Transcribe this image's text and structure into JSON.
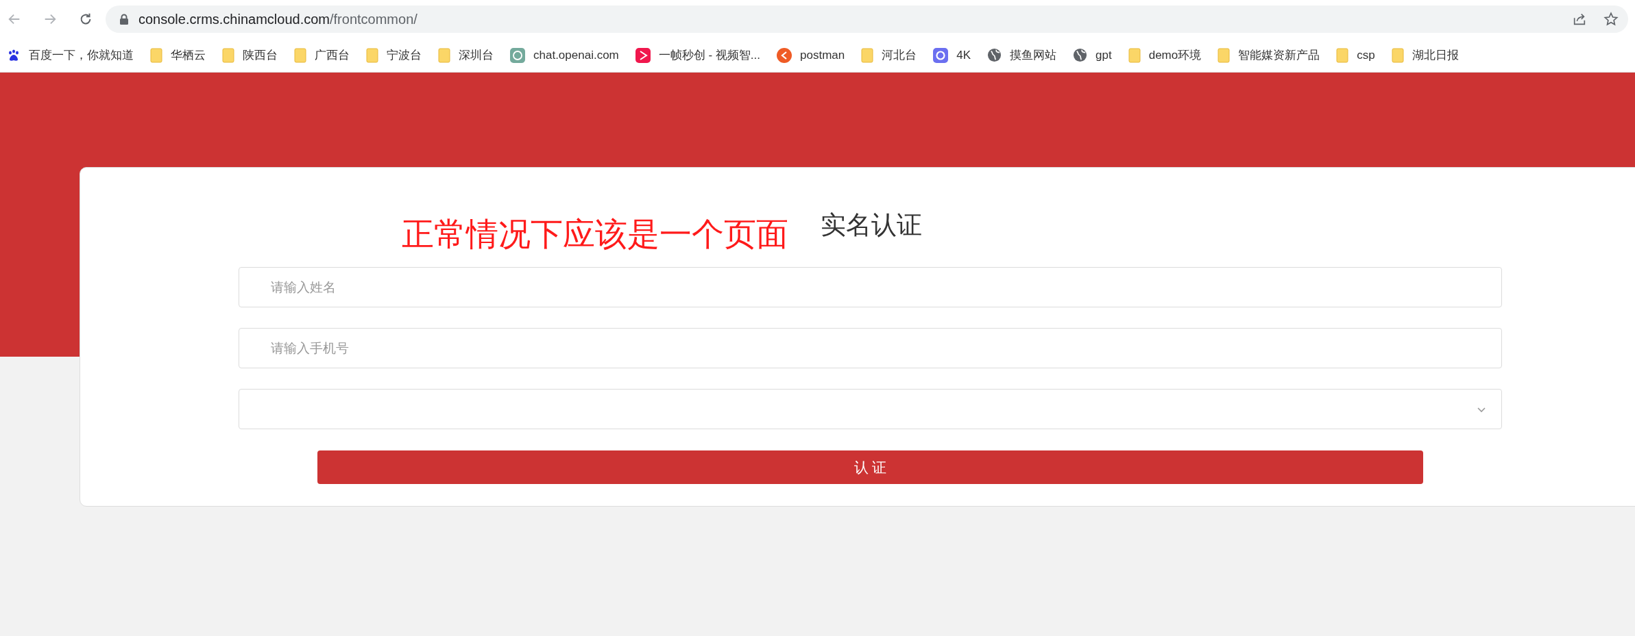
{
  "browser": {
    "url_host": "console.crms.chinamcloud.com",
    "url_path": "/frontcommon/"
  },
  "bookmarks": [
    {
      "label": "百度一下，你就知道",
      "kind": "paw"
    },
    {
      "label": "华栖云",
      "kind": "folder"
    },
    {
      "label": "陕西台",
      "kind": "folder"
    },
    {
      "label": "广西台",
      "kind": "folder"
    },
    {
      "label": "宁波台",
      "kind": "folder"
    },
    {
      "label": "深圳台",
      "kind": "folder"
    },
    {
      "label": "chat.openai.com",
      "kind": "knot"
    },
    {
      "label": "一帧秒创 - 视频智...",
      "kind": "play"
    },
    {
      "label": "postman",
      "kind": "rocket"
    },
    {
      "label": "河北台",
      "kind": "folder"
    },
    {
      "label": "4K",
      "kind": "ring"
    },
    {
      "label": "摸鱼网站",
      "kind": "globe"
    },
    {
      "label": "gpt",
      "kind": "globe"
    },
    {
      "label": "demo环境",
      "kind": "folder"
    },
    {
      "label": "智能媒资新产品",
      "kind": "folder"
    },
    {
      "label": "csp",
      "kind": "folder"
    },
    {
      "label": "湖北日报",
      "kind": "folder"
    }
  ],
  "form": {
    "title": "实名认证",
    "annotation": "正常情况下应该是一个页面",
    "fields": [
      {
        "placeholder": "请输入姓名",
        "kind": "text"
      },
      {
        "placeholder": "请输入手机号",
        "kind": "text"
      },
      {
        "kind": "select"
      }
    ],
    "submit": "认 证"
  }
}
